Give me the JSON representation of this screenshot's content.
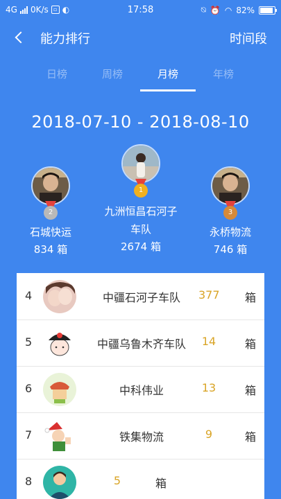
{
  "status_bar": {
    "network": "4G",
    "speed": "0K/s",
    "time": "17:58",
    "battery": "82%"
  },
  "header": {
    "title": "能力排行",
    "action": "时间段"
  },
  "tabs": [
    {
      "label": "日榜",
      "active": false
    },
    {
      "label": "周榜",
      "active": false
    },
    {
      "label": "月榜",
      "active": true
    },
    {
      "label": "年榜",
      "active": false
    }
  ],
  "date_range": "2018-07-10 - 2018-08-10",
  "podium": {
    "first": {
      "rank": "1",
      "name_line1": "九洲恒昌石河子",
      "name_line2": "车队",
      "value": "2674 箱"
    },
    "second": {
      "rank": "2",
      "name": "石城快运",
      "value": "834 箱"
    },
    "third": {
      "rank": "3",
      "name": "永桥物流",
      "value": "746 箱"
    }
  },
  "ranking": [
    {
      "rank": "4",
      "name": "中疆石河子车队",
      "value": "377",
      "unit": "箱"
    },
    {
      "rank": "5",
      "name": "中疆乌鲁木齐车队",
      "value": "14",
      "unit": "箱"
    },
    {
      "rank": "6",
      "name": "中科伟业",
      "value": "13",
      "unit": "箱"
    },
    {
      "rank": "7",
      "name": "铁集物流",
      "value": "9",
      "unit": "箱"
    },
    {
      "rank": "8",
      "name": "",
      "value": "5",
      "unit": "箱"
    }
  ],
  "colors": {
    "background": "#3f86ee",
    "value": "#d9a426",
    "silver": "#b9b9b9",
    "gold": "#f0b020",
    "bronze": "#d68a3a",
    "ribbon": "#e4423c"
  }
}
